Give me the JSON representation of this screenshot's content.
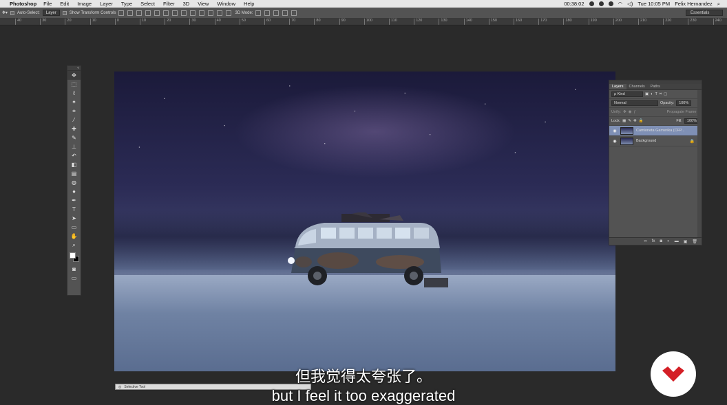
{
  "menubar": {
    "app_name": "Photoshop",
    "menus": [
      "File",
      "Edit",
      "Image",
      "Layer",
      "Type",
      "Select",
      "Filter",
      "3D",
      "View",
      "Window",
      "Help"
    ],
    "timer": "00:38:02",
    "clock": "Tue 10:05 PM",
    "user": "Felix Hernandez"
  },
  "options": {
    "auto_select_label": "Auto-Select:",
    "auto_select_value": "Layer",
    "show_transform_label": "Show Transform Controls",
    "mode_3d_label": "3D Mode:",
    "workspace": "Essentials"
  },
  "ruler": {
    "ticks": [
      "40",
      "30",
      "20",
      "10",
      "0",
      "10",
      "20",
      "30",
      "40",
      "50",
      "60",
      "70",
      "80",
      "90",
      "100",
      "110",
      "120",
      "130",
      "140",
      "150",
      "160",
      "170",
      "180",
      "190",
      "200",
      "210",
      "220",
      "230",
      "240"
    ]
  },
  "toolbox": {
    "tools": [
      {
        "name": "move-tool",
        "glyph": "✥"
      },
      {
        "name": "marquee-tool",
        "glyph": "⬚"
      },
      {
        "name": "lasso-tool",
        "glyph": "ℓ"
      },
      {
        "name": "quick-select-tool",
        "glyph": "✦"
      },
      {
        "name": "crop-tool",
        "glyph": "⌗"
      },
      {
        "name": "eyedropper-tool",
        "glyph": "⁄"
      },
      {
        "name": "healing-brush-tool",
        "glyph": "✚"
      },
      {
        "name": "brush-tool",
        "glyph": "✎"
      },
      {
        "name": "clone-stamp-tool",
        "glyph": "⊥"
      },
      {
        "name": "history-brush-tool",
        "glyph": "↶"
      },
      {
        "name": "eraser-tool",
        "glyph": "◧"
      },
      {
        "name": "gradient-tool",
        "glyph": "▤"
      },
      {
        "name": "blur-tool",
        "glyph": "◍"
      },
      {
        "name": "dodge-tool",
        "glyph": "●"
      },
      {
        "name": "pen-tool",
        "glyph": "✒"
      },
      {
        "name": "type-tool",
        "glyph": "T"
      },
      {
        "name": "path-select-tool",
        "glyph": "➤"
      },
      {
        "name": "rectangle-tool",
        "glyph": "▭"
      },
      {
        "name": "hand-tool",
        "glyph": "✋"
      },
      {
        "name": "zoom-tool",
        "glyph": "⌕"
      }
    ]
  },
  "layers_panel": {
    "tabs": [
      "Layers",
      "Channels",
      "Paths"
    ],
    "active_tab": "Layers",
    "filter_kind": "ρ Kind",
    "blend_mode": "Normal",
    "opacity_label": "Opacity:",
    "opacity_value": "100%",
    "unify_label": "Unify:",
    "propagate_label": "Propagate Frame 1",
    "lock_label": "Lock:",
    "fill_label": "Fill:",
    "fill_value": "100%",
    "layers": [
      {
        "name": "Camioneta Garnerika (CFP...",
        "selected": true,
        "locked": false
      },
      {
        "name": "Background",
        "selected": false,
        "locked": true
      }
    ]
  },
  "minipanel": {
    "title": "Selective Tool"
  },
  "subtitles": {
    "chinese": "但我觉得太夸张了。",
    "english": "but I feel it too exaggerated"
  },
  "colors": {
    "ps_ui": "#535353",
    "selected_layer": "#7f90b5",
    "logo_red": "#d41f26"
  }
}
